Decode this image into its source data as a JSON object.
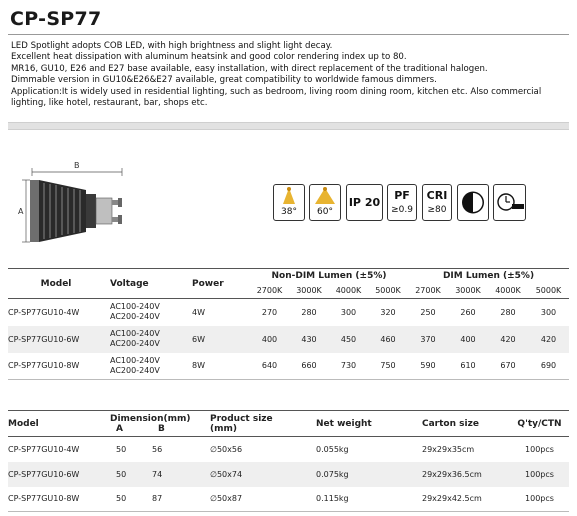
{
  "title": "CP-SP77",
  "description": [
    "LED Spotlight adopts COB LED, with high brightness and slight light decay.",
    "Excellent heat dissipation with aluminum heatsink and good color rendering index up to 80.",
    "MR16, GU10, E26 and E27 base available, easy installation, with direct replacement of the traditional halogen.",
    "Dimmable version in GU10&E26&E27 available, great compatibility to worldwide famous dimmers.",
    "Application:It is widely used in residential lighting, such as bedroom, living room dining room, kitchen etc. Also commercial lighting, like hotel, restaurant, bar, shops etc."
  ],
  "drawing": {
    "dim_a": "A",
    "dim_b": "B"
  },
  "feature_icons": {
    "beam38": "38°",
    "beam60": "60°",
    "ip": "IP 20",
    "pf_top": "PF",
    "pf_bottom": "≥0.9",
    "cri_top": "CRI",
    "cri_bottom": "≥80",
    "icons": [
      "beam-angle-icon",
      "beam-angle-icon",
      "ip-rating-icon",
      "power-factor-icon",
      "cri-icon",
      "dimmable-icon",
      "lifetime-icon"
    ]
  },
  "table1": {
    "headers": {
      "model": "Model",
      "voltage": "Voltage",
      "power": "Power",
      "nondim": "Non-DIM Lumen (±5%)",
      "dim": "DIM Lumen (±5%)"
    },
    "cct": [
      "2700K",
      "3000K",
      "4000K",
      "5000K"
    ],
    "rows": [
      {
        "model": "CP-SP77GU10-4W",
        "v1": "AC100-240V",
        "v2": "AC200-240V",
        "power": "4W",
        "nondim": [
          "270",
          "280",
          "300",
          "320"
        ],
        "dim": [
          "250",
          "260",
          "280",
          "300"
        ]
      },
      {
        "model": "CP-SP77GU10-6W",
        "v1": "AC100-240V",
        "v2": "AC200-240V",
        "power": "6W",
        "nondim": [
          "400",
          "430",
          "450",
          "460"
        ],
        "dim": [
          "370",
          "400",
          "420",
          "420"
        ]
      },
      {
        "model": "CP-SP77GU10-8W",
        "v1": "AC100-240V",
        "v2": "AC200-240V",
        "power": "8W",
        "nondim": [
          "640",
          "660",
          "730",
          "750"
        ],
        "dim": [
          "590",
          "610",
          "670",
          "690"
        ]
      }
    ]
  },
  "table2": {
    "headers": {
      "model": "Model",
      "dimension": "Dimension(mm)",
      "a": "A",
      "b": "B",
      "product_size": "Product size",
      "product_size_unit": "(mm)",
      "net_weight": "Net weight",
      "carton": "Carton size",
      "qty": "Q'ty/CTN"
    },
    "rows": [
      {
        "model": "CP-SP77GU10-4W",
        "a": "50",
        "b": "56",
        "size": "∅50x56",
        "weight": "0.055kg",
        "carton": "29x29x35cm",
        "qty": "100pcs"
      },
      {
        "model": "CP-SP77GU10-6W",
        "a": "50",
        "b": "74",
        "size": "∅50x74",
        "weight": "0.075kg",
        "carton": "29x29x36.5cm",
        "qty": "100pcs"
      },
      {
        "model": "CP-SP77GU10-8W",
        "a": "50",
        "b": "87",
        "size": "∅50x87",
        "weight": "0.115kg",
        "carton": "29x29x42.5cm",
        "qty": "100pcs"
      }
    ]
  }
}
